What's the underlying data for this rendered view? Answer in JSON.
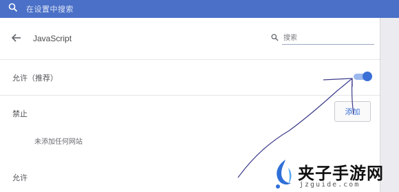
{
  "topbar": {
    "search_text": "在设置中搜索",
    "icon": "search-icon"
  },
  "header": {
    "back_icon": "arrow-left-icon",
    "title": "JavaScript",
    "search_icon": "search-icon",
    "search_placeholder": "搜索"
  },
  "allow_row": {
    "label": "允许（推荐）",
    "toggle_on": true
  },
  "block_section": {
    "label": "禁止",
    "add_label": "添加",
    "empty_text": "未添加任何网站"
  },
  "allow_section": {
    "label": "允许"
  },
  "colors": {
    "topbar": "#4a70c7",
    "accent": "#3a6fd6",
    "annotation": "#3c3a8a"
  },
  "watermark": {
    "brand": "夹子手游网",
    "url": "jzguide.com"
  }
}
